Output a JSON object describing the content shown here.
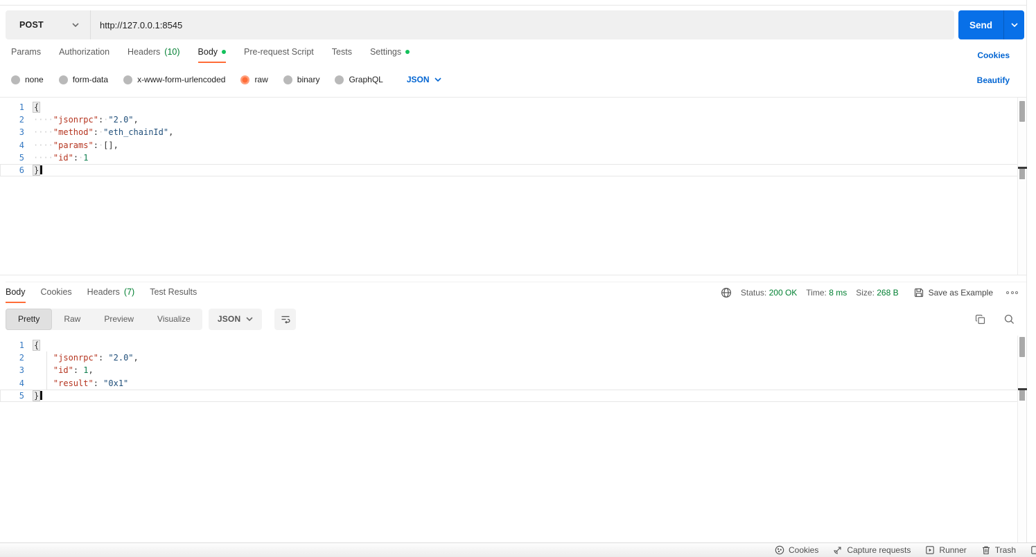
{
  "request": {
    "method": "POST",
    "url": "http://127.0.0.1:8545",
    "send_label": "Send",
    "cookies_link": "Cookies",
    "beautify_link": "Beautify",
    "tabs": [
      {
        "label": "Params"
      },
      {
        "label": "Authorization"
      },
      {
        "label": "Headers",
        "count": "(10)"
      },
      {
        "label": "Body",
        "active": true,
        "dot": true
      },
      {
        "label": "Pre-request Script"
      },
      {
        "label": "Tests"
      },
      {
        "label": "Settings",
        "dot": true
      }
    ],
    "body_modes": [
      "none",
      "form-data",
      "x-www-form-urlencoded",
      "raw",
      "binary",
      "GraphQL"
    ],
    "selected_mode": "raw",
    "language": "JSON",
    "code_lines": [
      {
        "num": "1",
        "tokens": [
          {
            "c": "brace",
            "t": "{"
          }
        ]
      },
      {
        "num": "2",
        "tokens": [
          {
            "c": "ws",
            "t": "····"
          },
          {
            "c": "key",
            "t": "\"jsonrpc\""
          },
          {
            "c": "pun",
            "t": ":"
          },
          {
            "c": "ws",
            "t": "·"
          },
          {
            "c": "str",
            "t": "\"2.0\""
          },
          {
            "c": "pun",
            "t": ","
          }
        ]
      },
      {
        "num": "3",
        "tokens": [
          {
            "c": "ws",
            "t": "····"
          },
          {
            "c": "key",
            "t": "\"method\""
          },
          {
            "c": "pun",
            "t": ":"
          },
          {
            "c": "ws",
            "t": "·"
          },
          {
            "c": "str",
            "t": "\"eth_chainId\""
          },
          {
            "c": "pun",
            "t": ","
          }
        ]
      },
      {
        "num": "4",
        "tokens": [
          {
            "c": "ws",
            "t": "····"
          },
          {
            "c": "key",
            "t": "\"params\""
          },
          {
            "c": "pun",
            "t": ":"
          },
          {
            "c": "ws",
            "t": "·"
          },
          {
            "c": "pun",
            "t": "[],"
          }
        ]
      },
      {
        "num": "5",
        "tokens": [
          {
            "c": "ws",
            "t": "····"
          },
          {
            "c": "key",
            "t": "\"id\""
          },
          {
            "c": "pun",
            "t": ":"
          },
          {
            "c": "ws",
            "t": "·"
          },
          {
            "c": "num",
            "t": "1"
          }
        ]
      },
      {
        "num": "6",
        "active": true,
        "tokens": [
          {
            "c": "brace",
            "t": "}"
          },
          {
            "c": "cursor",
            "t": ""
          }
        ]
      }
    ]
  },
  "response": {
    "tabs": [
      {
        "label": "Body",
        "active": true
      },
      {
        "label": "Cookies"
      },
      {
        "label": "Headers",
        "count": "(7)"
      },
      {
        "label": "Test Results"
      }
    ],
    "meta": {
      "status_label": "Status:",
      "status_value": "200 OK",
      "time_label": "Time:",
      "time_value": "8 ms",
      "size_label": "Size:",
      "size_value": "268 B",
      "save_as_example": "Save as Example"
    },
    "views": [
      "Pretty",
      "Raw",
      "Preview",
      "Visualize"
    ],
    "selected_view": "Pretty",
    "language": "JSON",
    "code_lines": [
      {
        "num": "1",
        "tokens": [
          {
            "c": "brace",
            "t": "{"
          }
        ]
      },
      {
        "num": "2",
        "tokens": [
          {
            "c": "sp",
            "t": "    "
          },
          {
            "c": "key",
            "t": "\"jsonrpc\""
          },
          {
            "c": "pun",
            "t": ": "
          },
          {
            "c": "str",
            "t": "\"2.0\""
          },
          {
            "c": "pun",
            "t": ","
          }
        ]
      },
      {
        "num": "3",
        "tokens": [
          {
            "c": "sp",
            "t": "    "
          },
          {
            "c": "key",
            "t": "\"id\""
          },
          {
            "c": "pun",
            "t": ": "
          },
          {
            "c": "num",
            "t": "1"
          },
          {
            "c": "pun",
            "t": ","
          }
        ]
      },
      {
        "num": "4",
        "tokens": [
          {
            "c": "sp",
            "t": "    "
          },
          {
            "c": "key",
            "t": "\"result\""
          },
          {
            "c": "pun",
            "t": ": "
          },
          {
            "c": "str",
            "t": "\"0x1\""
          }
        ]
      },
      {
        "num": "5",
        "active": true,
        "tokens": [
          {
            "c": "brace",
            "t": "}"
          },
          {
            "c": "cursor",
            "t": ""
          }
        ]
      }
    ]
  },
  "statusbar": {
    "cookies": "Cookies",
    "capture_requests": "Capture requests",
    "runner": "Runner",
    "trash": "Trash"
  },
  "colors": {
    "accent_orange": "#ff6c37",
    "send_blue": "#0870e8",
    "link_blue": "#0265d2",
    "count_green": "#007f31",
    "dot_green": "#13c15b",
    "key_red": "#b5341f",
    "string_navy": "#1f4e79",
    "number_green": "#0e7e4e",
    "gutter_blue": "#3579c2"
  }
}
